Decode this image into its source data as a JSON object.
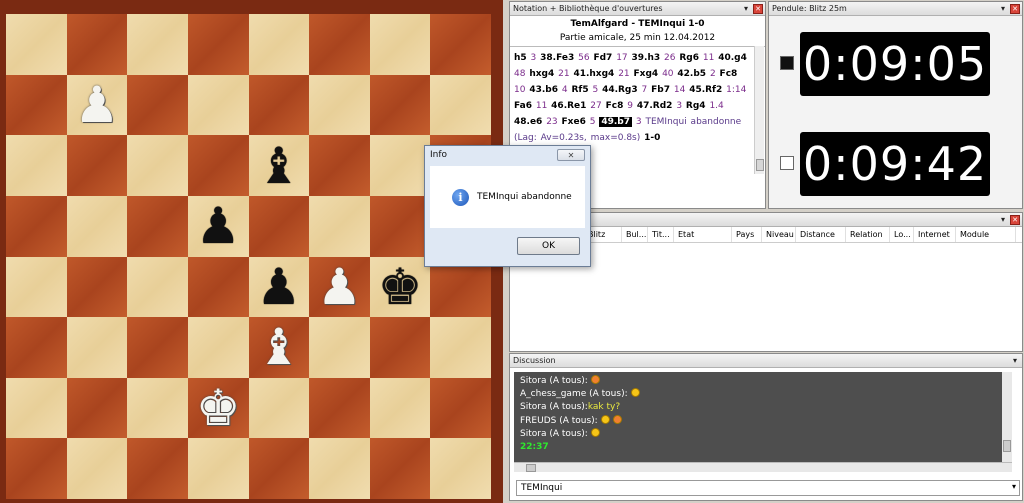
{
  "board": {
    "squares": [
      [
        "",
        "",
        "",
        "",
        "",
        "",
        "",
        ""
      ],
      [
        "",
        "wP",
        "",
        "",
        "",
        "",
        "",
        ""
      ],
      [
        "",
        "",
        "",
        "",
        "bB",
        "",
        "",
        ""
      ],
      [
        "",
        "",
        "",
        "bP",
        "",
        "",
        "",
        ""
      ],
      [
        "",
        "",
        "",
        "",
        "bP",
        "wP",
        "bK",
        ""
      ],
      [
        "",
        "",
        "",
        "",
        "wB",
        "",
        "",
        ""
      ],
      [
        "",
        "",
        "",
        "wK",
        "",
        "",
        "",
        ""
      ],
      [
        "",
        "",
        "",
        "",
        "",
        "",
        "",
        ""
      ]
    ]
  },
  "notation": {
    "panel_title": "Notation + Bibliothèque d'ouvertures",
    "game_title": "TemAlfgard - TEMInqui  1-0",
    "game_subtitle": "Partie amicale, 25 min 12.04.2012",
    "moves": [
      {
        "t": "mv",
        "s": "h5"
      },
      {
        "t": "tm",
        "s": "3"
      },
      {
        "t": "mv",
        "s": "38.Fe3"
      },
      {
        "t": "tm",
        "s": "56"
      },
      {
        "t": "mv",
        "s": "Fd7"
      },
      {
        "t": "tm",
        "s": "17"
      },
      {
        "t": "mv",
        "s": "39.h3"
      },
      {
        "t": "tm",
        "s": "26"
      },
      {
        "t": "mv",
        "s": "Rg6"
      },
      {
        "t": "tm",
        "s": "11"
      },
      {
        "t": "mv",
        "s": "40.g4"
      },
      {
        "t": "tm",
        "s": "48"
      },
      {
        "t": "mv",
        "s": "hxg4"
      },
      {
        "t": "tm",
        "s": "21"
      },
      {
        "t": "mv",
        "s": "41.hxg4"
      },
      {
        "t": "tm",
        "s": "21"
      },
      {
        "t": "mv",
        "s": "Fxg4"
      },
      {
        "t": "tm",
        "s": "40"
      },
      {
        "t": "mv",
        "s": "42.b5"
      },
      {
        "t": "tm",
        "s": "2"
      },
      {
        "t": "mv",
        "s": "Fc8"
      },
      {
        "t": "tm",
        "s": "10"
      },
      {
        "t": "mv",
        "s": "43.b6"
      },
      {
        "t": "tm",
        "s": "4"
      },
      {
        "t": "mv",
        "s": "Rf5"
      },
      {
        "t": "tm",
        "s": "5"
      },
      {
        "t": "mv",
        "s": "44.Rg3"
      },
      {
        "t": "tm",
        "s": "7"
      },
      {
        "t": "mv",
        "s": "Fb7"
      },
      {
        "t": "tm",
        "s": "14"
      },
      {
        "t": "mv",
        "s": "45.Rf2"
      },
      {
        "t": "tm",
        "s": "1:14"
      },
      {
        "t": "mv",
        "s": "Fa6"
      },
      {
        "t": "tm",
        "s": "11"
      },
      {
        "t": "mv",
        "s": "46.Re1"
      },
      {
        "t": "tm",
        "s": "27"
      },
      {
        "t": "mv",
        "s": "Fc8"
      },
      {
        "t": "tm",
        "s": "9"
      },
      {
        "t": "mv",
        "s": "47.Rd2"
      },
      {
        "t": "tm",
        "s": "3"
      },
      {
        "t": "mv",
        "s": "Rg4"
      },
      {
        "t": "tm",
        "s": "1.4"
      },
      {
        "t": "mv",
        "s": "48.e6"
      },
      {
        "t": "tm",
        "s": "23"
      },
      {
        "t": "mv",
        "s": "Fxe6"
      },
      {
        "t": "tm",
        "s": "5"
      },
      {
        "t": "cur",
        "s": "49.b7"
      },
      {
        "t": "tm",
        "s": "3"
      },
      {
        "t": "comment",
        "s": "TEMInqui abandonne  (Lag: Av=0.23s, max=0.8s)"
      },
      {
        "t": "mv",
        "s": "1-0"
      }
    ]
  },
  "clock": {
    "panel_title": "Pendule: Blitz 25m",
    "top_time": "0:09:05",
    "bottom_time": "0:09:42"
  },
  "players": {
    "columns": [
      "Blitz",
      "Bul...",
      "Tit...",
      "Etat",
      "Pays",
      "Niveau",
      "Distance",
      "Relation",
      "Lo...",
      "Internet",
      "Module"
    ]
  },
  "discussion": {
    "panel_title": "Discussion",
    "lines": [
      {
        "who": "Sitora (A tous):",
        "msg": "",
        "emoji": "red"
      },
      {
        "who": "A_chess_game (A tous):",
        "msg": "",
        "emoji": "yellow"
      },
      {
        "who": "Sitora (A tous):",
        "msg": "kak ty?",
        "emoji": ""
      },
      {
        "who": "FREUDS (A tous):",
        "msg": "",
        "emoji": "both"
      },
      {
        "who": "Sitora (A tous):",
        "msg": "",
        "emoji": "yellow"
      }
    ],
    "time": "22:37",
    "target": "TEMInqui"
  },
  "dialog": {
    "title": "Info",
    "message": "TEMInqui abandonne",
    "ok_label": "OK",
    "info_glyph": "i"
  }
}
